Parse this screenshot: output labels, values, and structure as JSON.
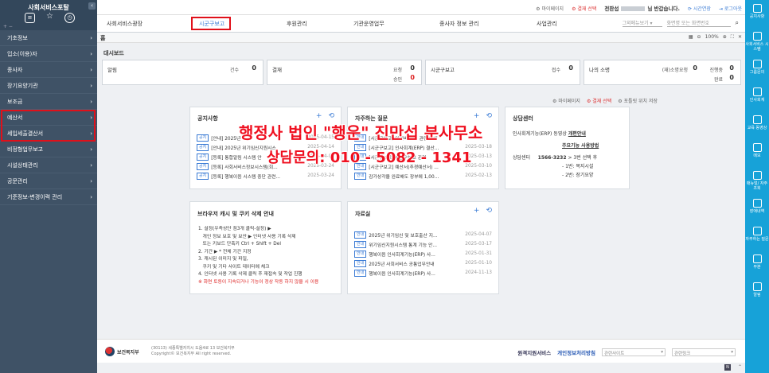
{
  "sidebar": {
    "title": "사회서비스포탈",
    "collapse": "‹",
    "toggle": "+ −",
    "items": [
      {
        "label": "기초정보"
      },
      {
        "label": "입소(이용)자"
      },
      {
        "label": "종사자"
      },
      {
        "label": "장기요양기관"
      },
      {
        "label": "보조금"
      },
      {
        "label": "예산서"
      },
      {
        "label": "세입세출결산서"
      },
      {
        "label": "비정형업무보고"
      },
      {
        "label": "시설상태관리"
      },
      {
        "label": "공문관리"
      },
      {
        "label": "기준정보-변경이력 관리"
      }
    ]
  },
  "topbar": {
    "mypage": "마이페이지",
    "role": "결재 선택",
    "user_prefix": "전판섭",
    "user_suffix": "님 반갑습니다.",
    "session": "시간연장",
    "logout": "로그아웃"
  },
  "nav": {
    "items": [
      "사회서비스광장",
      "시군구보고",
      "후원관리",
      "기관운영업무",
      "종사자 정보 관리",
      "사업관리"
    ],
    "menu_select": "그외메뉴보기",
    "search_placeholder": "화면명 또는 화면번호"
  },
  "tabs": {
    "home": "홈",
    "zoom": "100%"
  },
  "dashboard": {
    "title": "대시보드",
    "alarm": {
      "label": "알림",
      "count_label": "건수",
      "count": "0"
    },
    "approval": {
      "label": "결재",
      "req_label": "요청",
      "req": "0",
      "appr_label": "승인",
      "appr": "0"
    },
    "report": {
      "label": "시군구보고",
      "recv_label": "접수",
      "recv": "0"
    },
    "mine": {
      "label": "나의 소명",
      "req_label": "(재)소명요청",
      "req": "0",
      "prog_label": "진행중",
      "prog": "0",
      "done_label": "완료",
      "done": "0"
    }
  },
  "util": {
    "mypage": "마이페이지",
    "role": "결재 선택",
    "tool": "포틀릿 위치 저장"
  },
  "notice": {
    "title": "공지사항",
    "rows": [
      {
        "tag": "공지",
        "text": "[안내] 2025년 ",
        "date": "2025-04-15"
      },
      {
        "tag": "공지",
        "text": "[안내] 2025년 위기임신지원시스",
        "date": "2025-04-14"
      },
      {
        "tag": "공지",
        "text": "[등록] 통합알림 시스템 안",
        "date": "2025-04-09"
      },
      {
        "tag": "공지",
        "text": "[등록] 사회서비스정보시스템(회...",
        "date": "2025-03-24"
      },
      {
        "tag": "공지",
        "text": "[등록] 행복이음 시스템 중단 관련...",
        "date": "2025-03-24"
      }
    ]
  },
  "faq": {
    "title": "자주하는 질문",
    "rows": [
      {
        "tag": "안내",
        "text": "[시군구보고] 인건비 조회 관련 안내",
        "date": ""
      },
      {
        "tag": "안내",
        "text": "[시군구보고] 인사회계(ERP) 결산...",
        "date": "2025-03-18"
      },
      {
        "tag": "안내",
        "text": "[시군구보고] 시군구보고 관련",
        "date": "2025-03-13"
      },
      {
        "tag": "안내",
        "text": "[시군구보고] 예산서(추경예산서) ...",
        "date": "2025-03-10"
      },
      {
        "tag": "안내",
        "text": "감가상각을 완료해도 장부에 1,00...",
        "date": "2025-02-13"
      }
    ]
  },
  "consult": {
    "title": "상담센터",
    "erp_label": "인사회계기능(ERP) 동영상",
    "erp_link": "개편안내",
    "guide_link": "주요기능 사용방법",
    "center_label": "상담센터",
    "phone": "1566-3232",
    "phone_suffix": "> 3번 선택 후",
    "opt1": "- 1번: 복지시설",
    "opt2": "- 2번: 장기요양"
  },
  "browser": {
    "title": "브라우저 캐시 및 쿠키 삭제 안내",
    "lines": [
      "1. 설정(우측상단 점3개 클릭-설정) ▶",
      "   개인 정보 보호 및 보안 ▶ 인터넷 사용 기록 삭제",
      "   또는 키보드 단축키 Ctrl + Shift + Del",
      "2. 기간 ▶ * 전체 기간 지정",
      "3. 캐시된 이미지 및 파일,",
      "   쿠키 및 기타 사이트 데이터에 체크",
      "4. 인터넷 사용 기록 삭제 클릭 후 재접속 및 작업 진행",
      "※ 화면 토동이 지속되거나 기능이 정상 작동 하지 않을 시 이용"
    ]
  },
  "data_room": {
    "title": "자료실",
    "rows": [
      {
        "tag": "안내",
        "text": "2025년 위기임신 및 보호출산 지...",
        "date": "2025-04-07"
      },
      {
        "tag": "안내",
        "text": "위기임신지원시스템 통계 기능 안...",
        "date": "2025-03-17"
      },
      {
        "tag": "안내",
        "text": "행복이음 인사회계기능(ERP) 사...",
        "date": "2025-01-31"
      },
      {
        "tag": "안내",
        "text": "2025년 사회서비스 공통업무안내",
        "date": "2025-01-10"
      },
      {
        "tag": "안내",
        "text": "행복이음 인사회계기능(ERP) 사...",
        "date": "2024-11-13"
      }
    ]
  },
  "footer": {
    "org": "보건복지부",
    "addr1": "(30113) 세종특별자치시 도움4로 13 보건복지부",
    "addr2": "Copyright© 보건복지부 All right reserved.",
    "remote": "원격지원서비스",
    "privacy": "개인정보처리방침",
    "related_site": "관련사이트",
    "related_link": "관련링크"
  },
  "rightbar": {
    "items": [
      "공지사항",
      "사회서비스 시스템",
      "그룹문의",
      "인사회계",
      "교육 동영상",
      "메모",
      "매뉴얼/ 자주 조회",
      "장애내역",
      "자주하는 질문",
      "부분",
      "알림"
    ]
  },
  "watermark": {
    "line1": "행정사 법인 \"행운\" 진만섭 분사무소",
    "line2": "상담문의: 010 - 5082 - 1341"
  },
  "colors": {
    "sidebar": "#3f5266",
    "accent": "#17a2d8",
    "highlight": "#e0101a",
    "watermark": "#ef1020"
  }
}
